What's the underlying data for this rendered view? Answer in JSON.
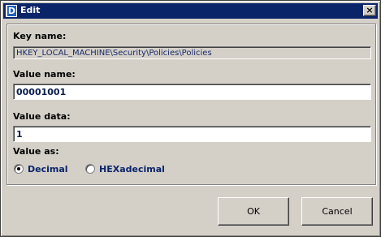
{
  "window": {
    "title": "Edit",
    "app_icon": "registry-editor-icon",
    "close_glyph": "×"
  },
  "key": {
    "label": "Key name:",
    "value": "HKEY_LOCAL_MACHINE\\Security\\Policies\\Policies"
  },
  "value_name": {
    "label": "Value name:",
    "value": "00001001"
  },
  "value_data": {
    "label": "Value data:",
    "value": "1"
  },
  "value_as": {
    "label": "Value as:",
    "options": [
      {
        "label": "Decimal",
        "selected": true
      },
      {
        "label": "HEXadecimal",
        "selected": false
      }
    ]
  },
  "buttons": {
    "ok": "OK",
    "cancel": "Cancel"
  },
  "colors": {
    "titlebar": "#0a246a",
    "face": "#d4d0c8"
  }
}
